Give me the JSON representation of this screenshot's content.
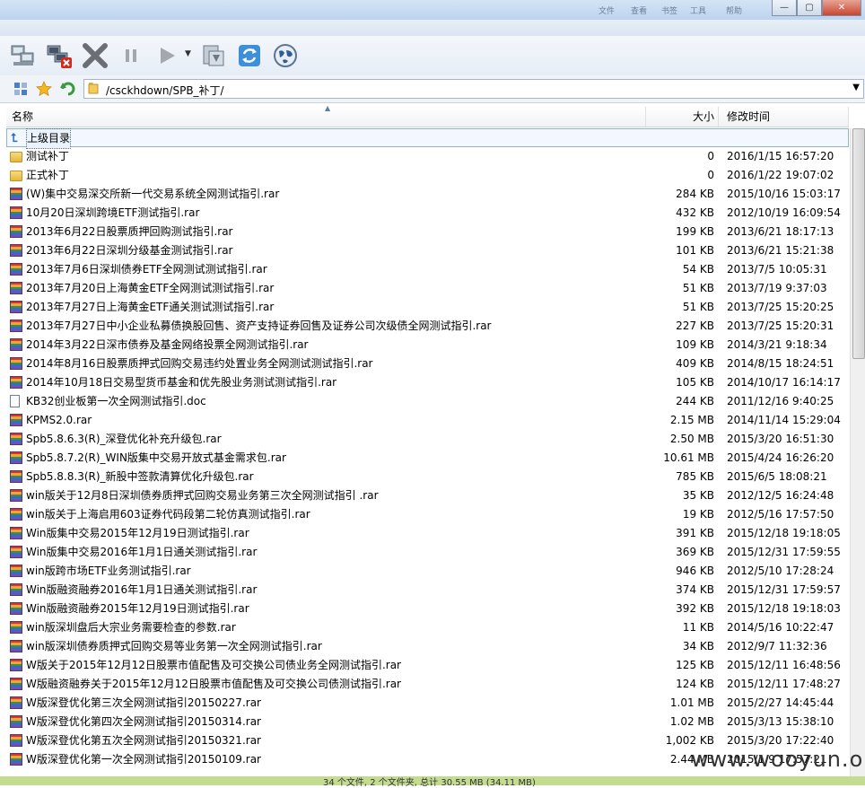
{
  "window": {
    "menu_ghost": [
      "文件",
      "查看",
      "书签",
      "工具",
      "帮助"
    ],
    "minimize": "—",
    "maximize": "▢",
    "close": "✕"
  },
  "toolbar": {
    "buttons": [
      {
        "name": "connect-icon"
      },
      {
        "name": "disconnect-icon"
      },
      {
        "name": "stop-icon"
      },
      {
        "name": "pause-icon"
      },
      {
        "name": "play-icon"
      },
      {
        "name": "download-icon"
      },
      {
        "name": "refresh-icon"
      },
      {
        "name": "globe-icon"
      }
    ]
  },
  "address": {
    "path": "/csckhdown/SPB_补丁/"
  },
  "columns": {
    "name": "名称",
    "size": "大小",
    "modified": "修改时间"
  },
  "rows": [
    {
      "type": "up",
      "name": "上级目录",
      "size": "",
      "time": ""
    },
    {
      "type": "folder",
      "name": "测试补丁",
      "size": "0",
      "time": "2016/1/15 16:57:20"
    },
    {
      "type": "folder",
      "name": "正式补丁",
      "size": "0",
      "time": "2016/1/22 19:07:02"
    },
    {
      "type": "rar",
      "name": "(W)集中交易深交所新一代交易系统全网测试指引.rar",
      "size": "284 KB",
      "time": "2015/10/16 15:03:17"
    },
    {
      "type": "rar",
      "name": "10月20日深圳跨境ETF测试指引.rar",
      "size": "432 KB",
      "time": "2012/10/19 16:09:54"
    },
    {
      "type": "rar",
      "name": "2013年6月22日股票质押回购测试指引.rar",
      "size": "199 KB",
      "time": "2013/6/21 18:17:13"
    },
    {
      "type": "rar",
      "name": "2013年6月22日深圳分级基金测试指引.rar",
      "size": "101 KB",
      "time": "2013/6/21 15:21:38"
    },
    {
      "type": "rar",
      "name": "2013年7月6日深圳债券ETF全网测试测试指引.rar",
      "size": "54 KB",
      "time": "2013/7/5 10:05:31"
    },
    {
      "type": "rar",
      "name": "2013年7月20日上海黄金ETF全网测试测试指引.rar",
      "size": "51 KB",
      "time": "2013/7/19 9:37:03"
    },
    {
      "type": "rar",
      "name": "2013年7月27日上海黄金ETF通关测试测试指引.rar",
      "size": "51 KB",
      "time": "2013/7/25 15:20:25"
    },
    {
      "type": "rar",
      "name": "2013年7月27日中小企业私募债换股回售、资产支持证券回售及证券公司次级债全网测试指引.rar",
      "size": "227 KB",
      "time": "2013/7/25 15:20:31"
    },
    {
      "type": "rar",
      "name": "2014年3月22日深市债券及基金网络投票全网测试指引.rar",
      "size": "109 KB",
      "time": "2014/3/21 9:18:34"
    },
    {
      "type": "rar",
      "name": "2014年8月16日股票质押式回购交易违约处置业务全网测试测试指引.rar",
      "size": "409 KB",
      "time": "2014/8/15 18:24:51"
    },
    {
      "type": "rar",
      "name": "2014年10月18日交易型货币基金和优先股业务测试测试指引.rar",
      "size": "105 KB",
      "time": "2014/10/17 16:14:17"
    },
    {
      "type": "doc",
      "name": "KB32创业板第一次全网测试指引.doc",
      "size": "244 KB",
      "time": "2011/12/16 9:40:25"
    },
    {
      "type": "rar",
      "name": "KPMS2.0.rar",
      "size": "2.15 MB",
      "time": "2014/11/14 15:29:04"
    },
    {
      "type": "rar",
      "name": "Spb5.8.6.3(R)_深登优化补充升级包.rar",
      "size": "2.50 MB",
      "time": "2015/3/20 16:51:30"
    },
    {
      "type": "rar",
      "name": "Spb5.8.7.2(R)_WIN版集中交易开放式基金需求包.rar",
      "size": "10.61 MB",
      "time": "2015/4/24 16:26:20"
    },
    {
      "type": "rar",
      "name": "Spb5.8.8.3(R)_新股中签款清算优化升级包.rar",
      "size": "785 KB",
      "time": "2015/6/5 18:08:21"
    },
    {
      "type": "rar",
      "name": "win版关于12月8日深圳债券质押式回购交易业务第三次全网测试指引 .rar",
      "size": "35 KB",
      "time": "2012/12/5 16:24:48"
    },
    {
      "type": "rar",
      "name": "win版关于上海启用603证券代码段第二轮仿真测试指引.rar",
      "size": "19 KB",
      "time": "2012/5/16 17:57:50"
    },
    {
      "type": "rar",
      "name": "Win版集中交易2015年12月19日测试指引.rar",
      "size": "391 KB",
      "time": "2015/12/18 19:18:05"
    },
    {
      "type": "rar",
      "name": "Win版集中交易2016年1月1日通关测试指引.rar",
      "size": "369 KB",
      "time": "2015/12/31 17:59:55"
    },
    {
      "type": "rar",
      "name": "win版跨市场ETF业务测试指引.rar",
      "size": "946 KB",
      "time": "2012/5/10 17:28:24"
    },
    {
      "type": "rar",
      "name": "Win版融资融券2016年1月1日通关测试指引.rar",
      "size": "374 KB",
      "time": "2015/12/31 17:59:57"
    },
    {
      "type": "rar",
      "name": "Win版融资融券2015年12月19日测试指引.rar",
      "size": "392 KB",
      "time": "2015/12/18 19:18:03"
    },
    {
      "type": "rar",
      "name": "win版深圳盘后大宗业务需要检查的参数.rar",
      "size": "11 KB",
      "time": "2014/5/16 10:22:47"
    },
    {
      "type": "rar",
      "name": "win版深圳债券质押式回购交易等业务第一次全网测试指引.rar",
      "size": "34 KB",
      "time": "2012/9/7 11:32:36"
    },
    {
      "type": "rar",
      "name": "W版关于2015年12月12日股票市值配售及可交换公司债业务全网测试指引.rar",
      "size": "125 KB",
      "time": "2015/12/11 16:48:56"
    },
    {
      "type": "rar",
      "name": "W版融资融券关于2015年12月12日股票市值配售及可交换公司债测试指引.rar",
      "size": "124 KB",
      "time": "2015/12/11 17:48:27"
    },
    {
      "type": "rar",
      "name": "W版深登优化第三次全网测试指引20150227.rar",
      "size": "1.01 MB",
      "time": "2015/2/27 14:45:44"
    },
    {
      "type": "rar",
      "name": "W版深登优化第四次全网测试指引20150314.rar",
      "size": "1.02 MB",
      "time": "2015/3/13 15:38:10"
    },
    {
      "type": "rar",
      "name": "W版深登优化第五次全网测试指引20150321.rar",
      "size": "1,002 KB",
      "time": "2015/3/20 17:22:40"
    },
    {
      "type": "rar",
      "name": "W版深登优化第一次全网测试指引20150109.rar",
      "size": "2.44 MB",
      "time": "2015/1/9 17:57:21"
    }
  ],
  "status": {
    "text": "34 个文件, 2 个文件夹, 总计 30.55 MB (34.11 MB)"
  },
  "watermark": "www.wooyun.org",
  "colors": {
    "titlebar": "#bcd3ee",
    "statusbar": "#c3dc8f",
    "selection_border": "#90b2d8"
  }
}
